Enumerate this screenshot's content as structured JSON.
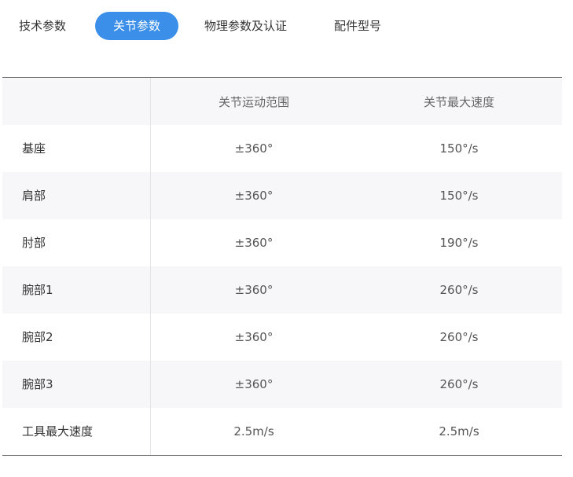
{
  "tabs": [
    {
      "label": "技术参数",
      "active": false
    },
    {
      "label": "关节参数",
      "active": true
    },
    {
      "label": "物理参数及认证",
      "active": false
    },
    {
      "label": "配件型号",
      "active": false
    }
  ],
  "colors": {
    "accent": "#3b8fe8",
    "row_shade": "#f7f7f9",
    "text": "#333333"
  },
  "table": {
    "headers": [
      "",
      "关节运动范围",
      "关节最大速度"
    ],
    "rows": [
      {
        "name": "基座",
        "range": "±360°",
        "speed": "150°/s"
      },
      {
        "name": "肩部",
        "range": "±360°",
        "speed": "150°/s"
      },
      {
        "name": "肘部",
        "range": "±360°",
        "speed": "190°/s"
      },
      {
        "name": "腕部1",
        "range": "±360°",
        "speed": "260°/s"
      },
      {
        "name": "腕部2",
        "range": "±360°",
        "speed": "260°/s"
      },
      {
        "name": "腕部3",
        "range": "±360°",
        "speed": "260°/s"
      },
      {
        "name": "工具最大速度",
        "range": "2.5m/s",
        "speed": "2.5m/s"
      }
    ]
  }
}
